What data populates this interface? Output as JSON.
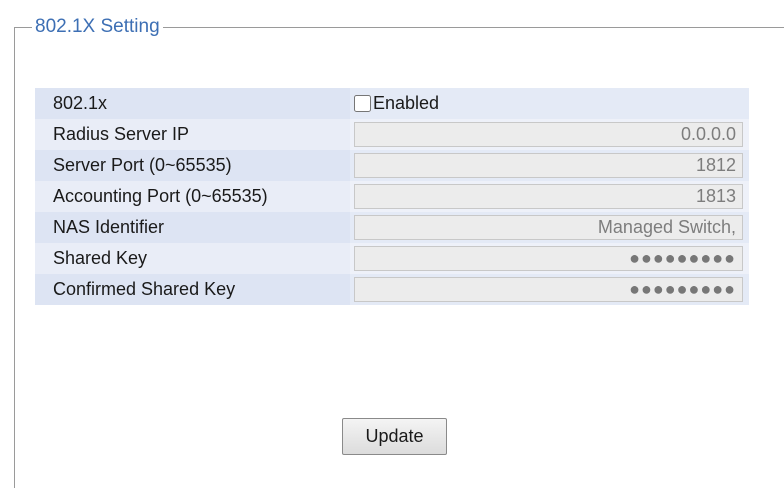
{
  "legend": "802.1X Setting",
  "rows": [
    {
      "label": "802.1x",
      "checkbox_label": "Enabled",
      "checked": false
    },
    {
      "label": "Radius Server IP",
      "value": "0.0.0.0"
    },
    {
      "label": "Server Port (0~65535)",
      "value": "1812"
    },
    {
      "label": "Accounting Port (0~65535)",
      "value": "1813"
    },
    {
      "label": "NAS Identifier",
      "value": "Managed Switch,"
    },
    {
      "label": "Shared Key",
      "value": "●●●●●●●●●"
    },
    {
      "label": "Confirmed Shared Key",
      "value": "●●●●●●●●●"
    }
  ],
  "button": {
    "update_label": "Update"
  }
}
